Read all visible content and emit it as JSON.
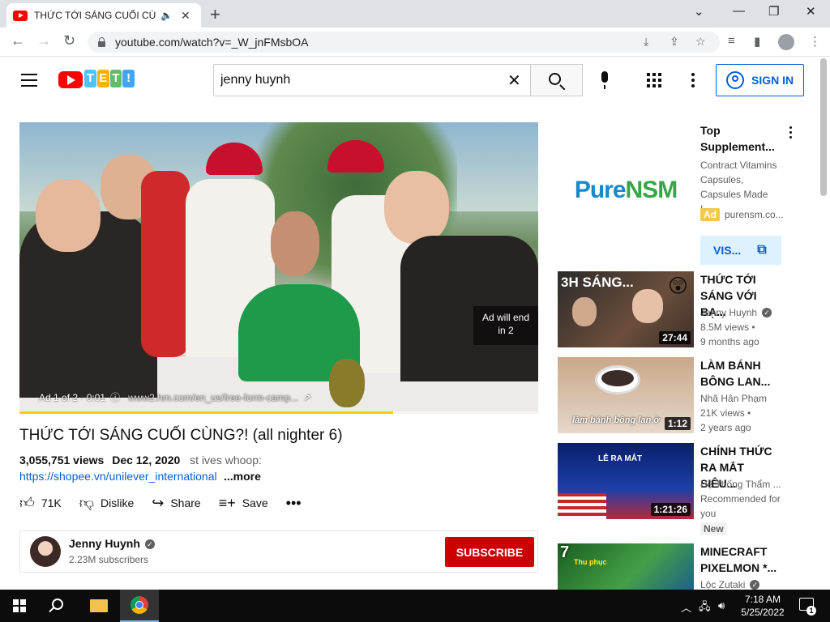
{
  "browser": {
    "tab_title": "THỨC TỚI SÁNG CUỐI CÙNG",
    "url": "youtube.com/watch?v=_W_jnFMsbOA"
  },
  "header": {
    "search_query": "jenny huynh",
    "signin_label": "SIGN IN",
    "doodle_letters": [
      "T",
      "E",
      "T",
      "!"
    ],
    "doodle_colors": [
      "#4fc3f7",
      "#ffb300",
      "#66bb6a",
      "#42a5f5"
    ]
  },
  "video": {
    "ad_will_end": "Ad will end",
    "ad_will_end_count": "in 2",
    "ad_counter": "Ad 1 of 2 · 0:01",
    "ad_url": "www2.hm.com/en_us/free-form-camp...",
    "progress": 0.72,
    "title": "THỨC TỚI SÁNG CUỐI CÙNG?! (all nighter 6)",
    "views": "3,055,751 views",
    "date": "Dec 12, 2020",
    "tag_text": "st ives whoop:",
    "link_text": "https://shopee.vn/unilever_international",
    "more_label": "...more"
  },
  "actions": {
    "like_count": "71K",
    "dislike_label": "Dislike",
    "share_label": "Share",
    "save_label": "Save"
  },
  "channel": {
    "name": "Jenny Huynh",
    "subscribers": "2.23M subscribers",
    "subscribe_label": "SUBSCRIBE"
  },
  "ad_card": {
    "brand_part1": "Pure",
    "brand_part2": "NSM",
    "title": "Top Supplement...",
    "description": "Contract Vitamins Capsules, Capsules Made I...",
    "badge": "Ad",
    "domain": "purensm.co...",
    "visit_label": "VIS..."
  },
  "recommendations": [
    {
      "title": "THỨC TỚI SÁNG VỚI BẠ...",
      "channel": "Jenny Huynh",
      "verified": true,
      "views": "8.5M views",
      "age": "9 months ago",
      "duration": "27:44",
      "thumb_text": "3H SÁNG..."
    },
    {
      "title": "LÀM BÁNH BÔNG LAN...",
      "channel": "Nhã Hân Phạm",
      "verified": false,
      "views": "21K views",
      "age": "2 years ago",
      "duration": "1:12",
      "thumb_text": "làm bánh bông lan ở"
    },
    {
      "title": "CHÍNH THỨC RA MẮT SIÊU...",
      "channel": "Hệ Thống Thẩm ...",
      "verified": false,
      "views": "Recommended for",
      "age": "you",
      "duration": "1:21:26",
      "badge": "New",
      "thumb_text": "LỄ RA MẮT"
    },
    {
      "title": "MINECRAFT PIXELMON *...",
      "channel": "Lộc Zutaki",
      "verified": true,
      "thumb_text": "7",
      "thumb_badge": "Thu phục"
    }
  ],
  "taskbar": {
    "time": "7:18 AM",
    "date": "5/25/2022",
    "notification_count": "1"
  }
}
